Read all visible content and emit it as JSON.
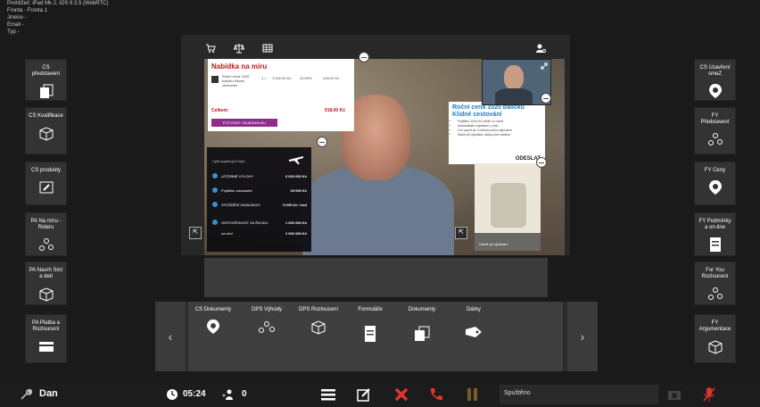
{
  "info_lines": [
    "Prohlížeč: iPad Mk 2, iOS 9.3.5 (WebRTC)",
    "Fronta - Fronta 1",
    "Jméno -",
    "Email -",
    "Typ -"
  ],
  "left_tiles": [
    {
      "label": "CS představení",
      "icon": "document-stack-icon"
    },
    {
      "label": "CS Kvalifikace",
      "icon": "box-icon"
    },
    {
      "label": "CS produkty",
      "icon": "checklist-icon"
    },
    {
      "label": "PA Na míru - Rideru",
      "icon": "nodes-icon"
    },
    {
      "label": "PA Navrh Smí a deti",
      "icon": "box-icon"
    },
    {
      "label": "PA Platba a Rozloucení",
      "icon": "card-icon"
    }
  ],
  "right_tiles": [
    {
      "label": "CS Uzavření smeZ",
      "icon": "location-pin-icon"
    },
    {
      "label": "FY Představení",
      "icon": "nodes-icon"
    },
    {
      "label": "FY Ceny",
      "icon": "location-pin-icon"
    },
    {
      "label": "FY Podmínky a on-line",
      "icon": "document-icon"
    },
    {
      "label": "For You Rozloucení",
      "icon": "nodes-icon"
    },
    {
      "label": "FY Argumentace",
      "icon": "box-icon"
    }
  ],
  "offer": {
    "title": "Nabídka na míru",
    "row_name": "Roční cena 1020 balíčku Klidné cestování",
    "row_qty": "1 ×",
    "row_price": "1 032,00 Kč",
    "row_discount": "10,00%",
    "row_total": "-100,00 Kč",
    "total_label": "Celkem:",
    "total_value": "918,00 Kč",
    "confirm_button": "POTVRDIT OBJEDNÁVKU"
  },
  "promo": {
    "title": "Roční cena 1020 balíčku Klidné cestování",
    "bullets": [
      "Pojištění 1020 Kč ušetří 1x ročně",
      "Automatické zaplacení z účtu",
      "Lze využít až 1 měsíční před odjezdem",
      "Dárek při sjednání: taška přes rameno"
    ],
    "send_label": "ODESLAT"
  },
  "insurance": {
    "header": "Výše pojistných krytí",
    "rows": [
      {
        "name": "LÉČEBNÉ VÝLOHY",
        "value": "5 000 000 Kč"
      },
      {
        "name": "Pojištění zavazadel",
        "value": "25 000 Kč"
      },
      {
        "name": "ZPOŽDĚNÍ ZAVAZADEL",
        "value": "5 000 Kč / hod"
      },
      {
        "name": "ODPOVĚDNOST ZA ŠKODU",
        "value": "1 000 000 Kč"
      },
      {
        "name": "na věci",
        "value": "2 000 000 Kč"
      }
    ]
  },
  "bag_caption": "Dárek při sjednání",
  "carousel": [
    {
      "label": "CS Dokumenty",
      "icon": "location-pin-icon"
    },
    {
      "label": "DPS Výhody",
      "icon": "nodes-icon"
    },
    {
      "label": "DPS Rozloucení",
      "icon": "box-icon"
    },
    {
      "label": "Formuláře",
      "icon": "document-icon"
    },
    {
      "label": "Dokumenty",
      "icon": "document-stack-icon"
    },
    {
      "label": "Dárky",
      "icon": "tag-icon"
    }
  ],
  "arrows": {
    "left": "‹",
    "right": "›"
  },
  "taskbar": {
    "user": "Dan",
    "timer": "05:24",
    "count": "0",
    "status": "Spuštěno"
  },
  "colors": {
    "offer_red": "#c0171c",
    "confirm_purple": "#8e2d8a",
    "promo_blue": "#1a7fbf",
    "hangup_red": "#e0352b"
  }
}
